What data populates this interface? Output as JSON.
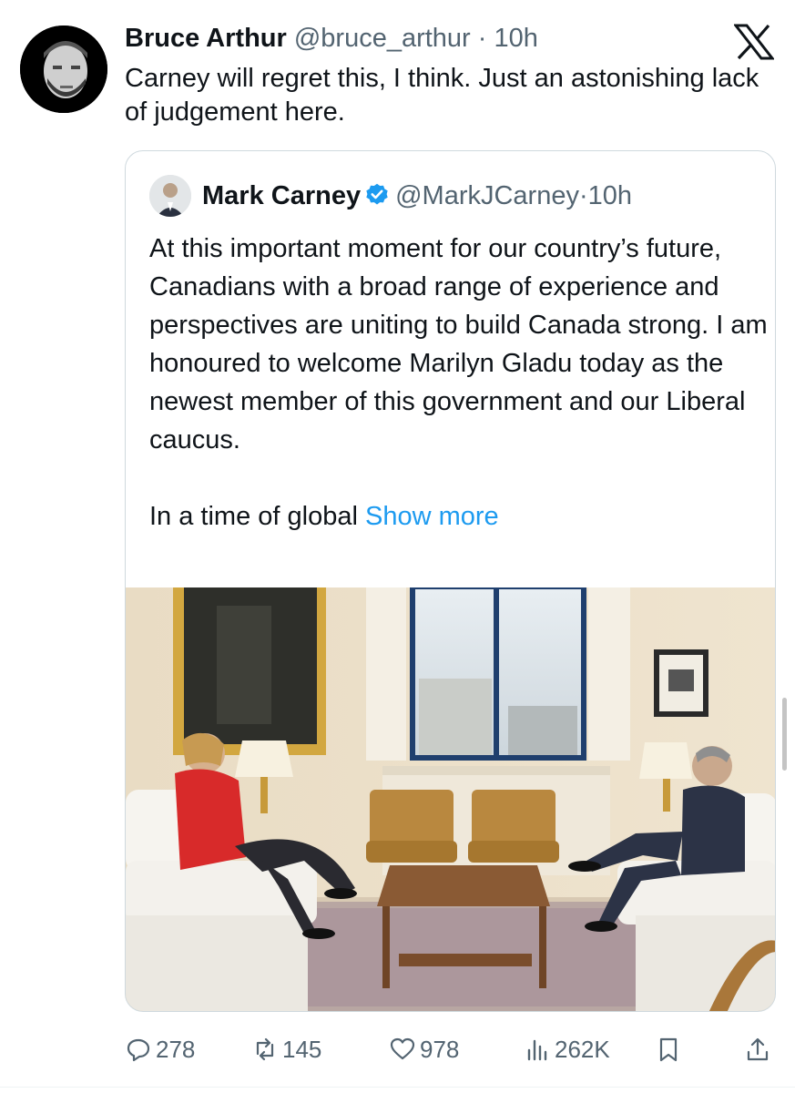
{
  "tweet": {
    "author_name": "Bruce Arthur",
    "author_handle": "@bruce_arthur",
    "separator": " · ",
    "time": "10h",
    "text": "Carney will regret this, I think. Just an astonishing lack of judgement here."
  },
  "quoted": {
    "author_name": "Mark Carney",
    "author_handle": "@MarkJCarney",
    "separator": "·",
    "time": "10h",
    "paragraph1": "At this important moment for our country’s future, Canadians with a broad range of experience and perspectives are uniting to build Canada strong. I am honoured to welcome Marilyn Gladu today as the newest member of this government and our Liberal caucus.",
    "paragraph2_prefix": "In a time of global ",
    "show_more": "Show more"
  },
  "actions": {
    "replies": "278",
    "reposts": "145",
    "likes": "978",
    "views": "262K"
  },
  "colors": {
    "text": "#0f1419",
    "muted": "#536471",
    "link": "#1d9bf0",
    "border": "#cfd9de",
    "verified": "#1d9bf0"
  },
  "icons": [
    "x-logo-icon",
    "verified-badge-icon",
    "reply-icon",
    "repost-icon",
    "like-icon",
    "views-icon",
    "bookmark-icon",
    "share-icon"
  ]
}
